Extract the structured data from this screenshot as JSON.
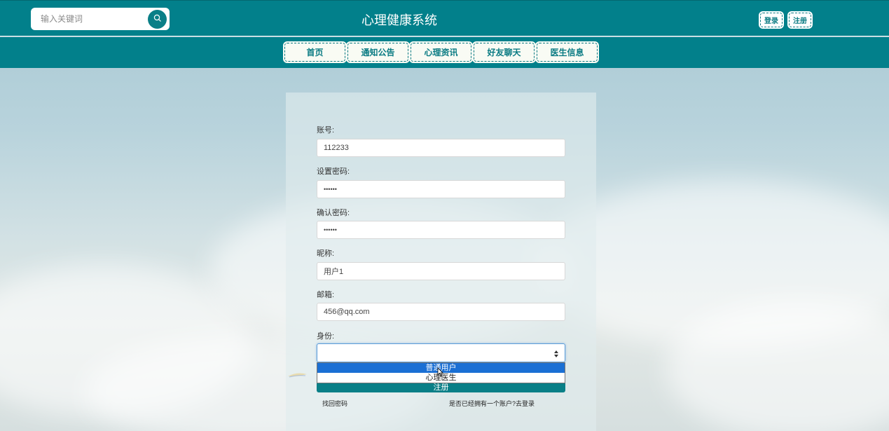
{
  "header": {
    "search_placeholder": "输入关键词",
    "site_title": "心理健康系统",
    "login_label": "登录",
    "register_label": "注册"
  },
  "nav": {
    "items": [
      {
        "label": "首页"
      },
      {
        "label": "通知公告"
      },
      {
        "label": "心理资讯"
      },
      {
        "label": "好友聊天"
      },
      {
        "label": "医生信息"
      }
    ]
  },
  "form": {
    "account": {
      "label": "账号:",
      "value": "112233"
    },
    "password": {
      "label": "设置密码:",
      "value": "••••••"
    },
    "confirm": {
      "label": "确认密码:",
      "value": "••••••"
    },
    "nickname": {
      "label": "昵称:",
      "value": "用户1"
    },
    "email": {
      "label": "邮箱:",
      "value": "456@qq.com"
    },
    "role": {
      "label": "身份:",
      "options": [
        "普通用户",
        "心理医生"
      ],
      "highlighted": "普通用户"
    },
    "submit_label": "注册",
    "forgot_label": "找回密码",
    "login_link_label": "是否已经拥有一个账户?去登录"
  },
  "colors": {
    "teal": "#02808b",
    "dropdown_highlight": "#1a6fd4"
  },
  "icons": {
    "search": "search-icon",
    "select": "select-arrows-icon",
    "cursor": "mouse-cursor-icon"
  }
}
